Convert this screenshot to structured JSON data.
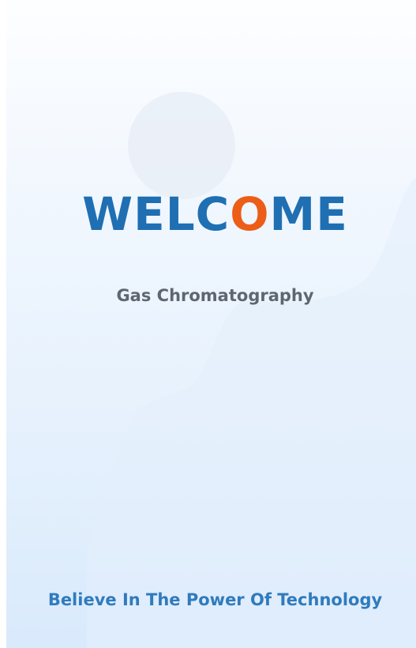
{
  "splash": {
    "welcome_parts": [
      "WELC",
      "O",
      "ME"
    ],
    "subtitle": "Gas Chromatography",
    "tagline": "Believe In The Power Of Technology"
  },
  "colors": {
    "title": "#1f6fb2",
    "title_accent": "#ec5d17",
    "subtitle": "#5f6670",
    "tagline": "#2f7bbd",
    "background_top": "#fdfeff",
    "background_bottom": "#d9eafc"
  }
}
